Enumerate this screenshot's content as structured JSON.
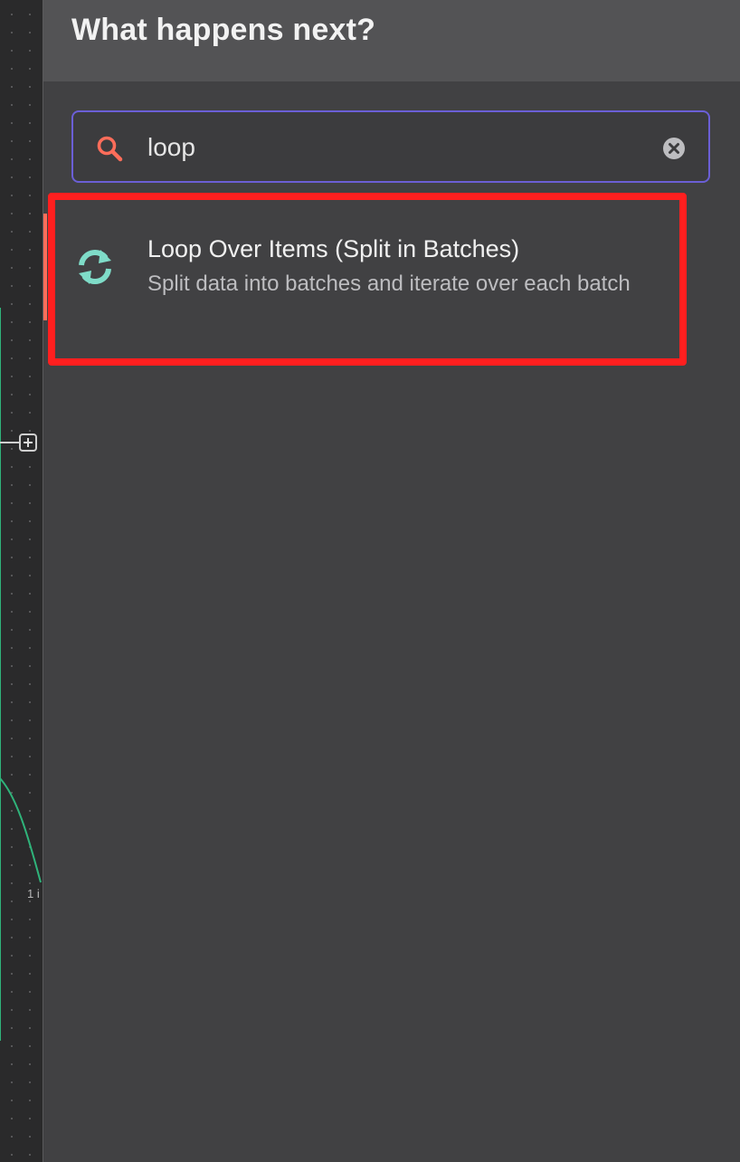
{
  "canvas": {
    "item_count_label": "1 i"
  },
  "panel": {
    "title": "What happens next?"
  },
  "search": {
    "value": "loop",
    "placeholder": "",
    "search_icon": "search-icon",
    "clear_icon": "clear-icon"
  },
  "results": [
    {
      "title": "Loop Over Items (Split in Batches)",
      "description": "Split data into batches and iterate over each batch",
      "icon": "refresh-icon",
      "selected": true
    }
  ],
  "colors": {
    "accent": "#ff6d5a",
    "search_border": "#6b5fd6",
    "icon_teal": "#7fdcc8",
    "highlight": "#ff1f1f",
    "connection": "#2fb37a"
  }
}
